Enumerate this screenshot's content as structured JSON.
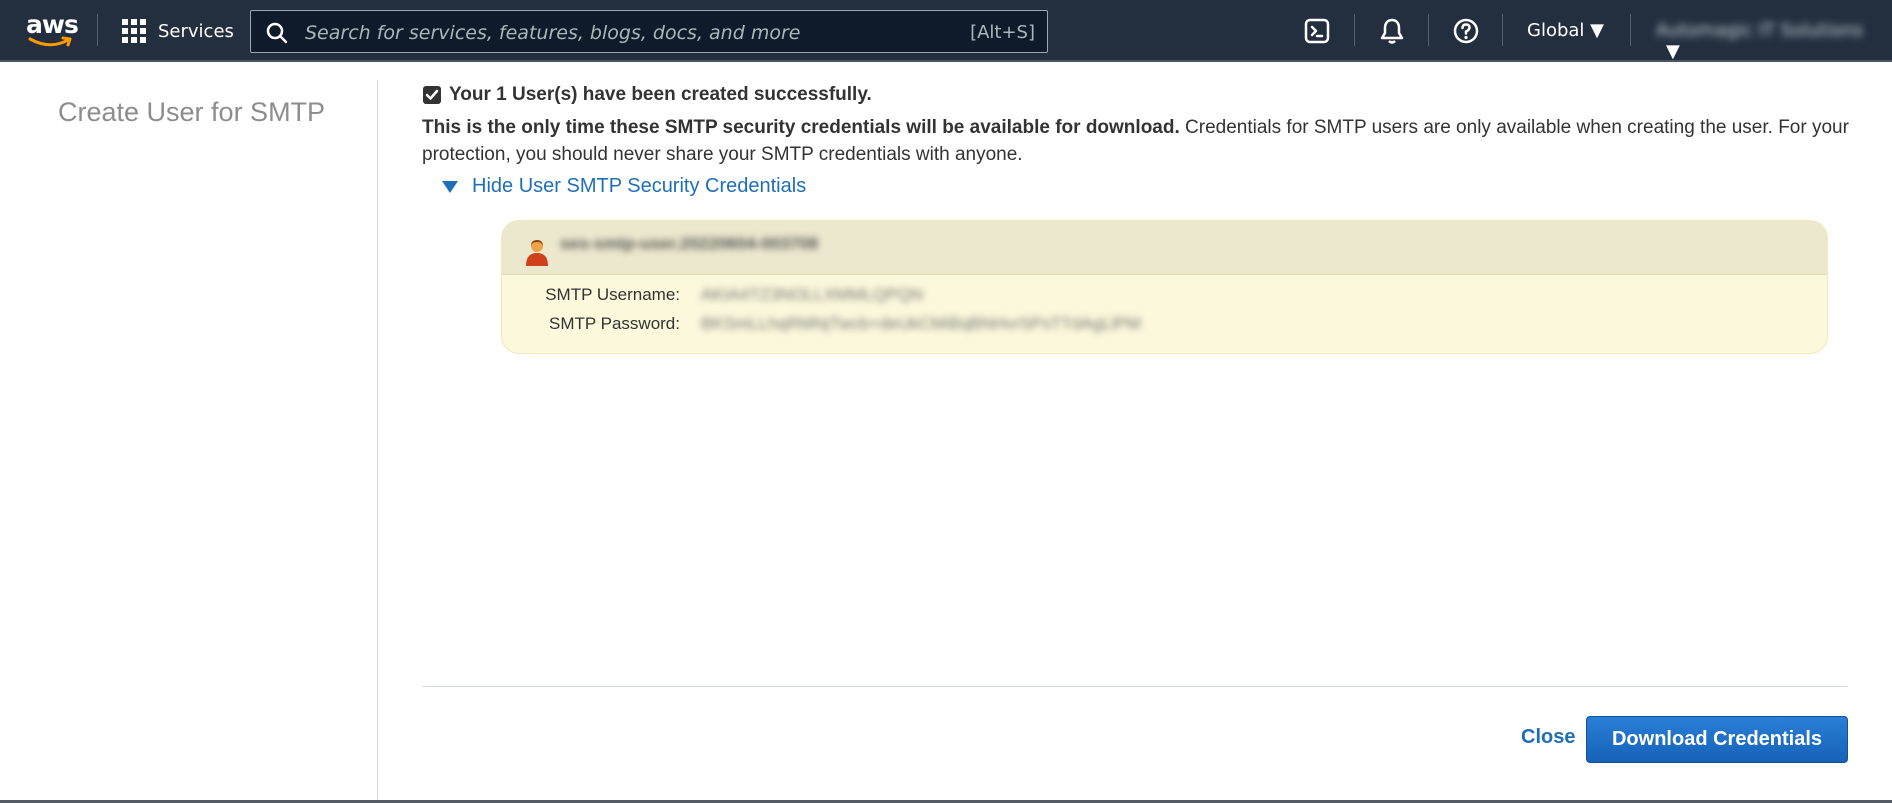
{
  "nav": {
    "logo": "aws",
    "services_label": "Services",
    "search_placeholder": "Search for services, features, blogs, docs, and more",
    "search_shortcut": "[Alt+S]",
    "region": "Global",
    "account": "Automagic IT Solutions",
    "icons": [
      "grid-icon",
      "search-icon",
      "cloudshell-icon",
      "bell-icon",
      "help-icon",
      "caret-down-icon"
    ]
  },
  "sidebar": {
    "title": "Create User for SMTP"
  },
  "main": {
    "success_message": "Your 1 User(s) have been created successfully.",
    "notice_bold": "This is the only time these SMTP security credentials will be available for download.",
    "notice_rest": " Credentials for SMTP users are only available when creating the user. For your protection, you should never share your SMTP credentials with anyone.",
    "toggle_label": "Hide User SMTP Security Credentials",
    "credentials": {
      "user_name": "ses-smtp-user.20220604-003708",
      "username_label": "SMTP Username:",
      "username_value": "AKIA4TZ3NOLLXMMLQPQN",
      "password_label": "SMTP Password:",
      "password_value": "BKSmLLhqRMNjTwcb+deUkCMiBqBNHvrSPsTTdAgLlPM"
    }
  },
  "footer": {
    "close_label": "Close",
    "download_label": "Download Credentials"
  },
  "colors": {
    "nav_bg": "#232f3e",
    "link": "#1f6fb8",
    "button": "#1f6fc6",
    "credentials_bg": "#fbf8dc"
  }
}
